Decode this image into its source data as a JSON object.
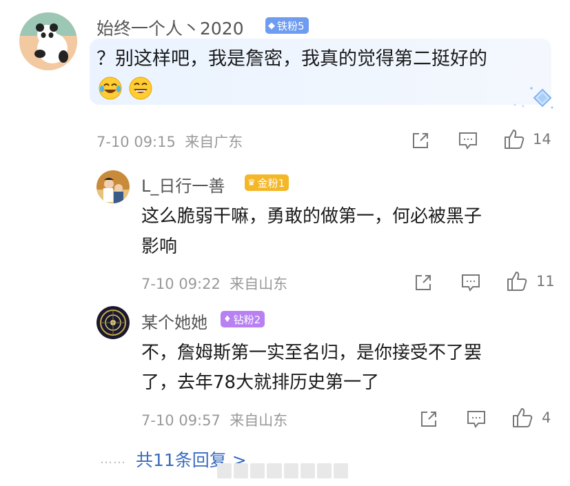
{
  "main_comment": {
    "username": "始终一个人丶2020",
    "badge": "铁粉5",
    "text_line1": "？别这样吧，我是詹密，我真的觉得第二挺好的",
    "emojis": [
      "crying-laughing-emoji",
      "laughing-emoji"
    ],
    "time": "7-10 09:15",
    "location": "来自广东",
    "likes": "14"
  },
  "replies": [
    {
      "username": "L_日行一善",
      "badge": "金粉1",
      "text_line1": "这么脆弱干嘛，勇敢的做第一，何必被黑子",
      "text_line2": "影响",
      "time": "7-10 09:22",
      "location": "来自山东",
      "likes": "11"
    },
    {
      "username": "某个她她",
      "badge": "钻粉2",
      "text_line1": "不，詹姆斯第一实至名归，是你接受不了罢",
      "text_line2": "了，去年78大就排历史第一了",
      "time": "7-10 09:57",
      "location": "来自山东",
      "likes": "4"
    }
  ],
  "footer": {
    "dots": "……",
    "more_replies": "共11条回复 >"
  },
  "icons": {
    "share": "share-icon",
    "comment": "comment-icon",
    "like": "thumbs-up-icon",
    "decoration": "diamond-sparkle-icon"
  },
  "colors": {
    "link": "#3a6bbf",
    "badge_iron": "#6d9cf0",
    "badge_gold": "#f4b728",
    "badge_diamond": "#b880f2",
    "bubble": "#eaf3ff"
  }
}
